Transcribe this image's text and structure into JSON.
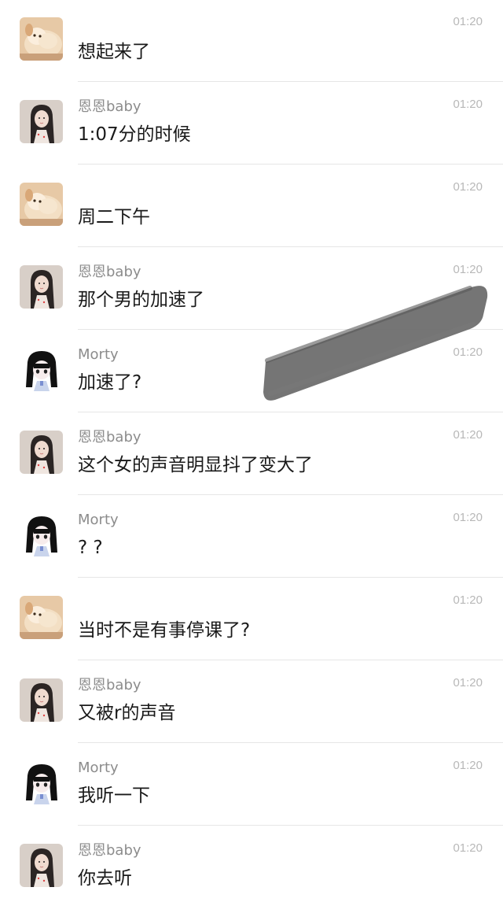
{
  "messages": [
    {
      "avatar": "dog-avatar",
      "sender": "",
      "time": "01:20",
      "text": "想起来了"
    },
    {
      "avatar": "girl-avatar",
      "sender": "恩恩baby",
      "time": "01:20",
      "text": "1:07分的时候"
    },
    {
      "avatar": "dog-avatar",
      "sender": "",
      "time": "01:20",
      "text": "周二下午"
    },
    {
      "avatar": "girl-avatar",
      "sender": "恩恩baby",
      "time": "01:20",
      "text": "那个男的加速了"
    },
    {
      "avatar": "anime-avatar",
      "sender": "Morty",
      "time": "01:20",
      "text": "加速了?"
    },
    {
      "avatar": "girl-avatar",
      "sender": "恩恩baby",
      "time": "01:20",
      "text": "这个女的声音明显抖了变大了"
    },
    {
      "avatar": "anime-avatar",
      "sender": "Morty",
      "time": "01:20",
      "text": "? ?"
    },
    {
      "avatar": "dog-avatar",
      "sender": "",
      "time": "01:20",
      "text": "当时不是有事停课了?"
    },
    {
      "avatar": "girl-avatar",
      "sender": "恩恩baby",
      "time": "01:20",
      "text": "又被r的声音"
    },
    {
      "avatar": "anime-avatar",
      "sender": "Morty",
      "time": "01:20",
      "text": "我听一下"
    },
    {
      "avatar": "girl-avatar",
      "sender": "恩恩baby",
      "time": "01:20",
      "text": "你去听"
    }
  ],
  "colors": {
    "text": "#1a1a1a",
    "sender": "#8c8c8c",
    "time": "#b8b8b8",
    "divider": "#e6e6e6",
    "redaction": "#6e6e6e"
  }
}
